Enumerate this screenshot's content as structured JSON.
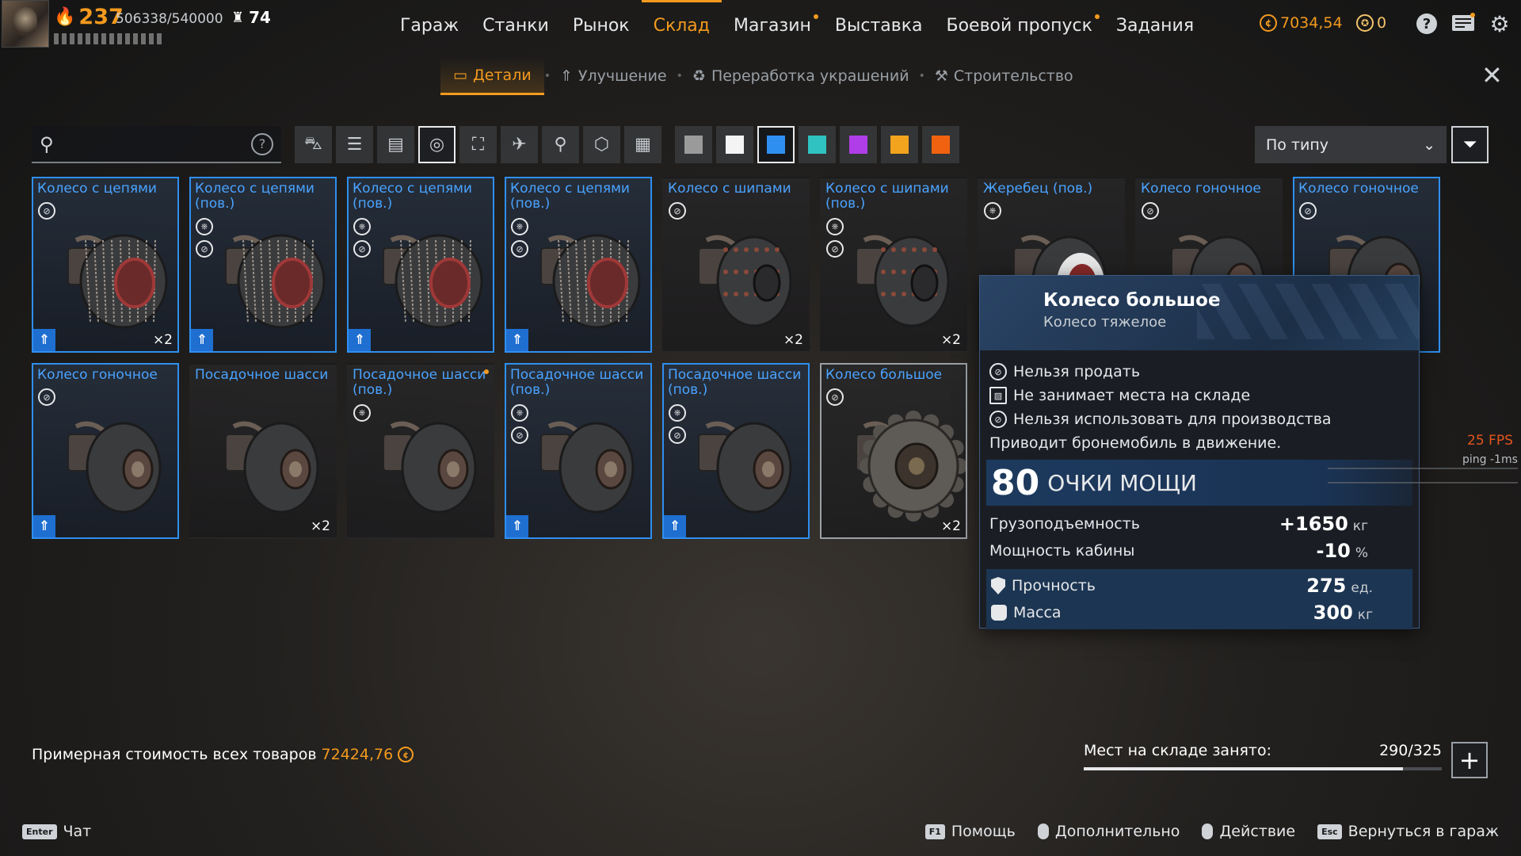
{
  "player": {
    "level": "237",
    "xp": "506338/540000",
    "rating": "74"
  },
  "main_nav": [
    {
      "label": "Гараж",
      "active": false,
      "dot": false
    },
    {
      "label": "Станки",
      "active": false,
      "dot": false
    },
    {
      "label": "Рынок",
      "active": false,
      "dot": false
    },
    {
      "label": "Склад",
      "active": true,
      "dot": false
    },
    {
      "label": "Магазин",
      "active": false,
      "dot": true
    },
    {
      "label": "Выставка",
      "active": false,
      "dot": false
    },
    {
      "label": "Боевой пропуск",
      "active": false,
      "dot": true
    },
    {
      "label": "Задания",
      "active": false,
      "dot": false
    }
  ],
  "currency": {
    "coins": "7034,54",
    "badges": "0"
  },
  "sub_nav": [
    {
      "label": "Детали",
      "active": true,
      "icon": "crate-icon"
    },
    {
      "label": "Улучшение",
      "active": false,
      "icon": "upgrade-icon"
    },
    {
      "label": "Переработка украшений",
      "active": false,
      "icon": "recycle-icon"
    },
    {
      "label": "Строительство",
      "active": false,
      "icon": "build-icon"
    }
  ],
  "search": {
    "value": "",
    "placeholder": ""
  },
  "category_filters": [
    {
      "icon": "cabin-icon",
      "glyph": "⛍",
      "active": false
    },
    {
      "icon": "weapon-icon",
      "glyph": "☰",
      "active": false
    },
    {
      "icon": "module-icon",
      "glyph": "▤",
      "active": false
    },
    {
      "icon": "wheel-icon",
      "glyph": "◎",
      "active": true
    },
    {
      "icon": "frame-icon",
      "glyph": "⛶",
      "active": false
    },
    {
      "icon": "decor-icon",
      "glyph": "✈",
      "active": false
    },
    {
      "icon": "paint-icon",
      "glyph": "⚲",
      "active": false
    },
    {
      "icon": "hexagon-icon",
      "glyph": "⬡",
      "active": false
    },
    {
      "icon": "all-grid-icon",
      "glyph": "▦",
      "active": false
    }
  ],
  "rarity_filters": [
    {
      "color": "#9a9a9a",
      "active": false
    },
    {
      "color": "#f4f4f4",
      "active": false
    },
    {
      "color": "#2f8ff0",
      "active": true
    },
    {
      "color": "#2fc2c0",
      "active": false
    },
    {
      "color": "#b03ee8",
      "active": false
    },
    {
      "color": "#f3a41e",
      "active": false
    },
    {
      "color": "#f0620f",
      "active": false
    }
  ],
  "sort": {
    "label": "По типу"
  },
  "items": [
    {
      "name": "Колесо с цепями",
      "rarity": "rare",
      "flags": [
        "no-sell"
      ],
      "upgrade": true,
      "count": "×2",
      "wheel": "chain",
      "new": false
    },
    {
      "name": "Колесо с цепями (пов.)",
      "rarity": "rare",
      "flags": [
        "steer",
        "no-sell"
      ],
      "upgrade": true,
      "count": "",
      "wheel": "chain",
      "new": false
    },
    {
      "name": "Колесо с цепями (пов.)",
      "rarity": "rare",
      "flags": [
        "steer",
        "no-sell"
      ],
      "upgrade": true,
      "count": "",
      "wheel": "chain",
      "new": false
    },
    {
      "name": "Колесо с цепями (пов.)",
      "rarity": "rare",
      "flags": [
        "steer",
        "no-sell"
      ],
      "upgrade": true,
      "count": "",
      "wheel": "chain",
      "new": false
    },
    {
      "name": "Колесо с шипами",
      "rarity": "common",
      "flags": [
        "no-sell"
      ],
      "upgrade": false,
      "count": "×2",
      "wheel": "spike",
      "new": false
    },
    {
      "name": "Колесо с шипами (пов.)",
      "rarity": "common",
      "flags": [
        "steer",
        "no-sell"
      ],
      "upgrade": false,
      "count": "×2",
      "wheel": "spike",
      "new": false
    },
    {
      "name": "Жеребец (пов.)",
      "rarity": "common",
      "flags": [
        "steer"
      ],
      "upgrade": false,
      "count": "",
      "wheel": "white",
      "new": false
    },
    {
      "name": "Колесо гоночное",
      "rarity": "common",
      "flags": [
        "no-sell"
      ],
      "upgrade": false,
      "count": "",
      "wheel": "race",
      "new": false
    },
    {
      "name": "Колесо гоночное",
      "rarity": "rare",
      "flags": [
        "no-sell"
      ],
      "upgrade": false,
      "count": "",
      "wheel": "race",
      "new": false
    },
    {
      "name": "Колесо гоночное",
      "rarity": "rare",
      "flags": [
        "no-sell"
      ],
      "upgrade": true,
      "count": "",
      "wheel": "race",
      "new": false
    },
    {
      "name": "Посадочное шасси",
      "rarity": "common",
      "flags": [],
      "upgrade": false,
      "count": "×2",
      "wheel": "landing",
      "new": false
    },
    {
      "name": "Посадочное шасси (пов.)",
      "rarity": "common",
      "flags": [
        "steer"
      ],
      "upgrade": false,
      "count": "",
      "wheel": "landing",
      "new": true
    },
    {
      "name": "Посадочное шасси (пов.)",
      "rarity": "rare",
      "flags": [
        "steer",
        "no-sell"
      ],
      "upgrade": true,
      "count": "",
      "wheel": "landing",
      "new": false
    },
    {
      "name": "Посадочное шасси (пов.)",
      "rarity": "rare",
      "flags": [
        "steer",
        "no-sell"
      ],
      "upgrade": true,
      "count": "",
      "wheel": "landing",
      "new": false
    },
    {
      "name": "Колесо большое",
      "rarity": "common",
      "flags": [
        "no-sell"
      ],
      "upgrade": false,
      "count": "×2",
      "wheel": "big",
      "new": false,
      "hover": true
    }
  ],
  "tooltip": {
    "title": "Колесо большое",
    "subtitle": "Колесо тяжелое",
    "properties": [
      {
        "icon": "no-sell-icon",
        "text": "Нельзя продать"
      },
      {
        "icon": "no-storage-icon",
        "text": "Не занимает места на складе"
      },
      {
        "icon": "no-craft-icon",
        "text": "Нельзя использовать для производства"
      },
      {
        "icon": "",
        "text": "Приводит бронемобиль в движение."
      }
    ],
    "power_value": "80",
    "power_label": "ОЧКИ МОЩИ",
    "stats": [
      {
        "label": "Грузоподъемность",
        "value": "+1650",
        "unit": "кг"
      },
      {
        "label": "Мощность кабины",
        "value": "-10",
        "unit": "%"
      }
    ],
    "durability": {
      "label": "Прочность",
      "value": "275",
      "unit": "ед."
    },
    "mass": {
      "label": "Масса",
      "value": "300",
      "unit": "кг"
    }
  },
  "total_value": {
    "label": "Примерная стоимость всех товаров",
    "value": "72424,76"
  },
  "storage": {
    "label": "Мест на складе занято:",
    "value": "290/325",
    "fill_fraction": 0.892
  },
  "perf": {
    "fps": "25 FPS",
    "ping": "ping -1ms"
  },
  "footer": {
    "chat_key": "Enter",
    "chat_label": "Чат",
    "help_key": "F1",
    "help_label": "Помощь",
    "more_label": "Дополнительно",
    "action_label": "Действие",
    "back_key": "Esc",
    "back_label": "Вернуться в гараж"
  }
}
